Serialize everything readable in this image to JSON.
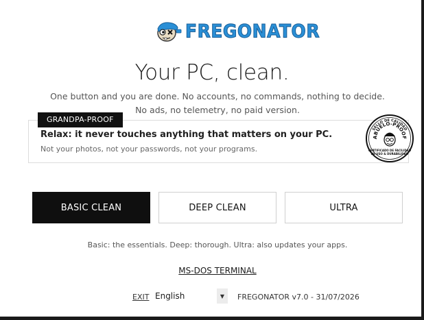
{
  "app": {
    "logo_text": "FREGONATOR"
  },
  "hero": {
    "title": "Your PC, clean.",
    "subtitle_line1": "One button and you are done. No accounts, no commands, nothing to decide.",
    "subtitle_line2": "No ads, no telemetry, no paid version."
  },
  "card": {
    "tag": "GRANDPA-PROOF",
    "title": "Relax: it never touches anything that matters on your PC.",
    "subtitle": "Not your photos, not your passwords, not your programs."
  },
  "seal": {
    "top_text": "SELLO DE CALIDAD",
    "main_text": "ABUELO-PROOF",
    "bottom_line1": "CERTIFICADO DE FACILIDAD",
    "bottom_line2": "DE USO & DURABILIDAD"
  },
  "modes": {
    "basic_label": "BASIC CLEAN",
    "deep_label": "DEEP CLEAN",
    "ultra_label": "ULTRA",
    "selected": "BASIC CLEAN",
    "hint": "Basic: the essentials. Deep: thorough. Ultra: also updates your apps."
  },
  "terminal": {
    "label": "MS-DOS TERMINAL"
  },
  "footer": {
    "exit_label": "EXIT",
    "language": "English",
    "version": "FREGONATOR v7.0 - 31/07/2026"
  },
  "colors": {
    "accent": "#2a8fd6",
    "active_button": "#0f0f0f",
    "tag_background": "#111111"
  },
  "icons": {
    "logo": "mascot-icon",
    "dropdown": "chevron-down-icon",
    "seal": "grandpa-seal-icon"
  }
}
